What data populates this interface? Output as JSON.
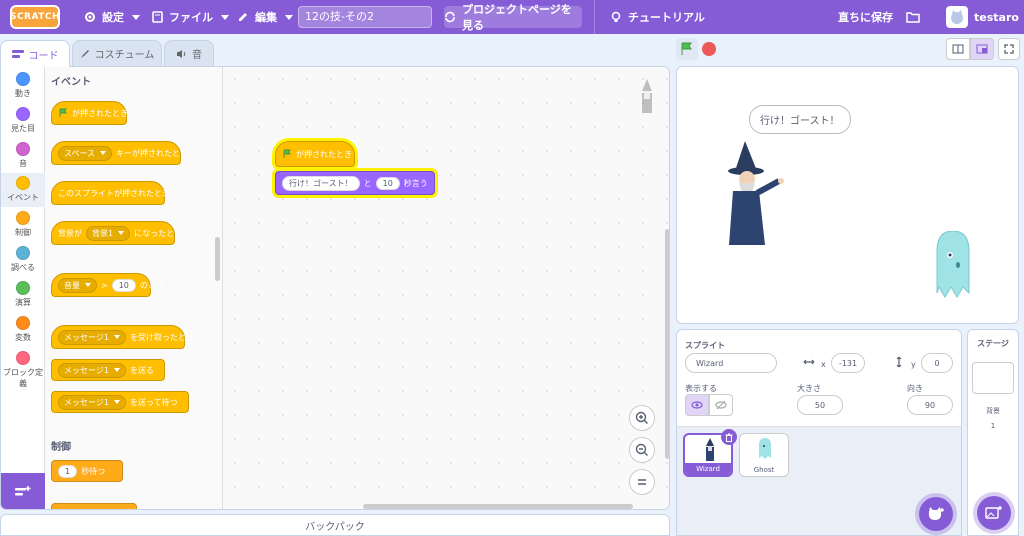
{
  "menubar": {
    "logo": "SCRATCH",
    "settings": "設定",
    "file": "ファイル",
    "edit": "編集",
    "project_title": "12の技-その2",
    "see_project_page": "プロジェクトページを見る",
    "tutorials": "チュートリアル",
    "save_now": "直ちに保存",
    "username": "testaro"
  },
  "tabs": {
    "code": "コード",
    "costumes": "コスチューム",
    "sounds": "音"
  },
  "categories": [
    {
      "label": "動き",
      "color": "#4c97ff"
    },
    {
      "label": "見た目",
      "color": "#9966ff"
    },
    {
      "label": "音",
      "color": "#cf63cf"
    },
    {
      "label": "イベント",
      "color": "#ffbf00"
    },
    {
      "label": "制御",
      "color": "#ffab19"
    },
    {
      "label": "調べる",
      "color": "#5cb1d6"
    },
    {
      "label": "演算",
      "color": "#59c059"
    },
    {
      "label": "変数",
      "color": "#ff8c1a"
    },
    {
      "label": "ブロック定義",
      "color": "#ff6680"
    }
  ],
  "palette": {
    "events_heading": "イベント",
    "control_heading": "制御",
    "flag_clicked": "が押されたとき",
    "key_dropdown": "スペース",
    "key_pressed": "キーが押されたとき",
    "sprite_clicked": "このスプライトが押されたとき",
    "backdrop_prefix": "背景が",
    "backdrop_dropdown": "背景1",
    "backdrop_suffix": "になったとき",
    "loudness_dropdown": "音量",
    "gt": ">",
    "loudness_value": "10",
    "loudness_suffix": "のとき",
    "message_dropdown1": "メッセージ1",
    "receive_suffix": "を受け取ったとき",
    "message_dropdown2": "メッセージ1",
    "broadcast_suffix": "を送る",
    "message_dropdown3": "メッセージ1",
    "broadcast_wait_suffix": "を送って待つ",
    "wait_value": "1",
    "wait_suffix": "秒待つ"
  },
  "script": {
    "hat_label": "が押されたとき",
    "say_text": "行け！ゴースト！",
    "say_and": "と",
    "say_secs": "10",
    "say_suffix": "秒言う"
  },
  "backpack": "バックパック",
  "stage": {
    "speech": "行け！ゴースト！"
  },
  "sprite_info": {
    "sprite_label": "スプライト",
    "sprite_name": "Wizard",
    "x_label": "x",
    "x_value": "-131",
    "y_label": "y",
    "y_value": "0",
    "show_label": "表示する",
    "size_label": "大きさ",
    "size_value": "50",
    "direction_label": "向き",
    "direction_value": "90"
  },
  "sprites": [
    {
      "name": "Wizard"
    },
    {
      "name": "Ghost"
    }
  ],
  "stage_panel": {
    "title": "ステージ",
    "backdrops_label": "背景",
    "backdrops_count": "1"
  }
}
